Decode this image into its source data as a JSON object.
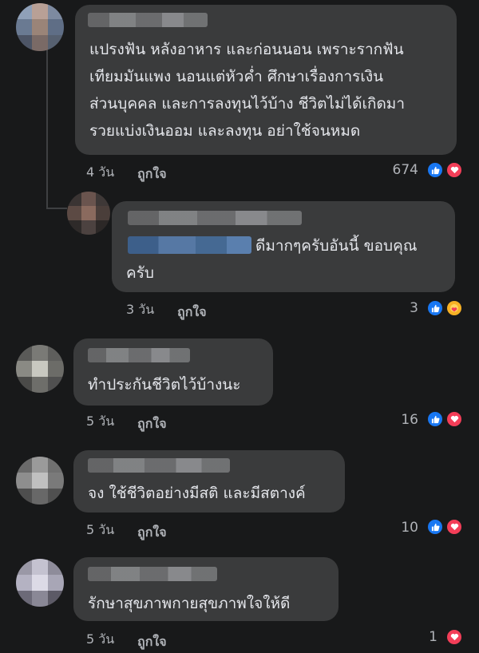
{
  "comments": [
    {
      "lines": [
        "แปรงฟัน หลังอาหาร และก่อนนอน เพราะรากฟัน",
        "เทียมมันแพง นอนแต่หัวค่ำ ศึกษาเรื่องการเงิน",
        "ส่วนบุคคล และการลงทุนไว้บ้าง ชีวิตไม่ได้เกิดมา",
        "รวยแบ่งเงินออม และลงทุน อย่าใช้จนหมด"
      ],
      "time": "4 วัน",
      "like_label": "ถูกใจ",
      "reaction_count": "674"
    },
    {
      "lines": [
        "ดีมากๆครับอันนี้ ขอบคุณ",
        "ครับ"
      ],
      "time": "3 วัน",
      "like_label": "ถูกใจ",
      "reaction_count": "3"
    },
    {
      "lines": [
        "ทำประกันชีวิตไว้บ้างนะ"
      ],
      "time": "5 วัน",
      "like_label": "ถูกใจ",
      "reaction_count": "16"
    },
    {
      "lines": [
        "จง ใช้ชีวิตอย่างมีสติ และมีสตางค์"
      ],
      "time": "5 วัน",
      "like_label": "ถูกใจ",
      "reaction_count": "10"
    },
    {
      "lines": [
        "รักษาสุขภาพกายสุขภาพใจให้ดี"
      ],
      "time": "5 วัน",
      "like_label": "ถูกใจ",
      "reaction_count": "1"
    }
  ],
  "icons": {
    "like": "like-reaction-icon",
    "love": "love-reaction-icon",
    "care": "care-reaction-icon"
  },
  "colors": {
    "background": "#18191a",
    "bubble": "#3a3b3c",
    "like": "#1877f2",
    "love": "#f33e58",
    "care": "#f7b125"
  }
}
